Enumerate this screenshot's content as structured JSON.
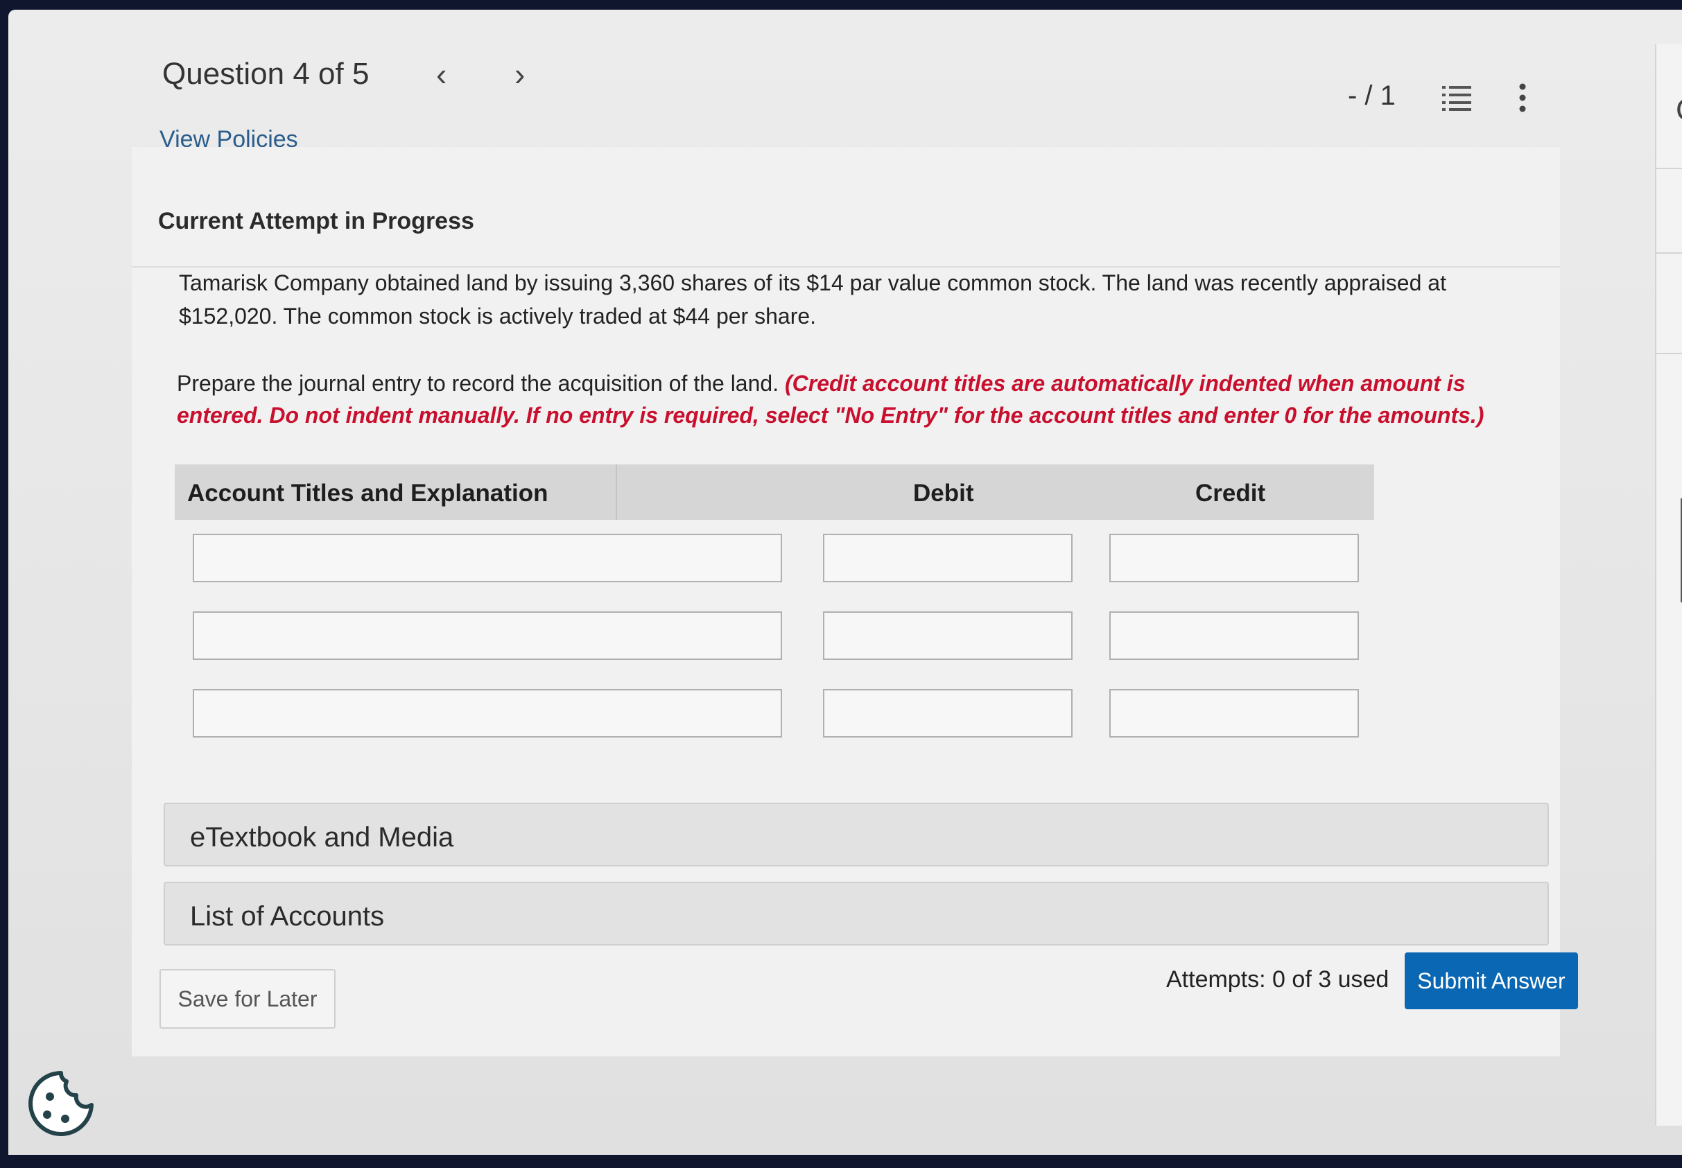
{
  "header": {
    "title": "Question 4 of 5",
    "prev_icon": "‹",
    "next_icon": "›",
    "view_policies": "View Policies",
    "score": "- / 1",
    "icons": {
      "list": "list-icon",
      "more": "vertical-ellipsis-icon"
    }
  },
  "question": {
    "attempt_heading": "Current Attempt in Progress",
    "problem_text": "Tamarisk Company obtained land by issuing 3,360 shares of its $14 par value common stock. The land was recently appraised at $152,020. The common stock is actively traded at $44 per share.",
    "instruction": "Prepare the journal entry to record the acquisition of the land.",
    "instruction_note": "(Credit account titles are automatically indented when amount is entered. Do not indent manually. If no entry is required, select \"No Entry\" for the account titles and enter 0 for the amounts.)"
  },
  "journal": {
    "columns": [
      "Account Titles and Explanation",
      "Debit",
      "Credit"
    ],
    "rows": [
      {
        "account": "",
        "debit": "",
        "credit": ""
      },
      {
        "account": "",
        "debit": "",
        "credit": ""
      },
      {
        "account": "",
        "debit": "",
        "credit": ""
      }
    ]
  },
  "accordions": {
    "etextbook": "eTextbook and Media",
    "list_of_accounts": "List of Accounts"
  },
  "footer": {
    "save_label": "Save for Later",
    "attempts": "Attempts: 0 of 3 used",
    "submit_label": "Submit Answer"
  },
  "colors": {
    "submit": "#0a67b4",
    "link": "#2a5d8c",
    "instruction_red": "#c8102e"
  }
}
